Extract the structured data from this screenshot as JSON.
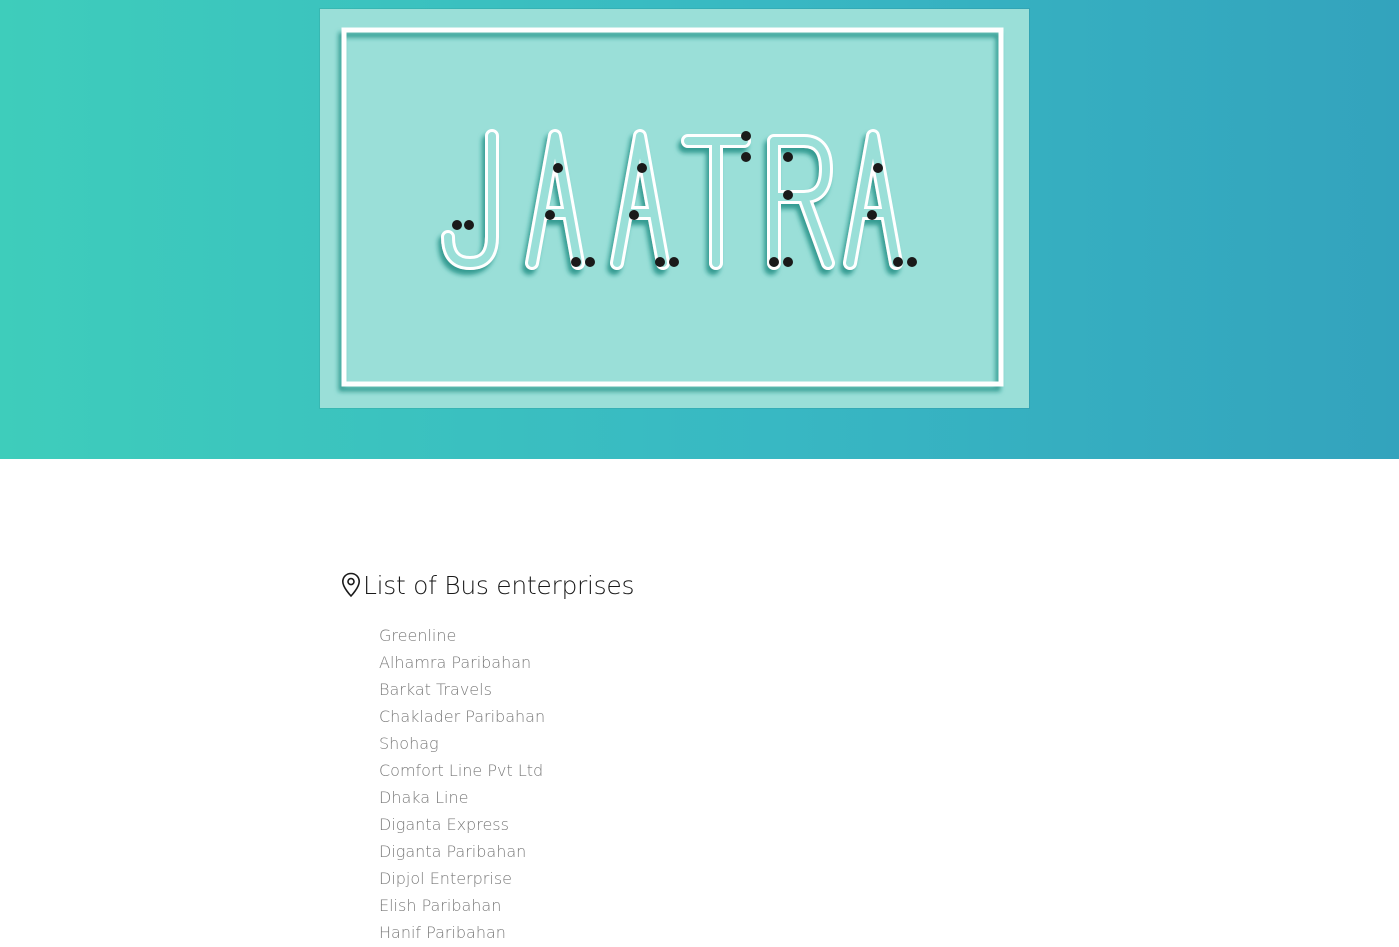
{
  "hero": {
    "logo_text": "JAATRA",
    "icon": "neon-sign-logo"
  },
  "section": {
    "icon": "map-pin-icon",
    "title": "List of Bus enterprises"
  },
  "bus_enterprises": [
    "Greenline",
    "Alhamra Paribahan",
    "Barkat Travels",
    "Chaklader Paribahan",
    "Shohag",
    "Comfort Line Pvt Ltd",
    "Dhaka Line",
    "Diganta Express",
    "Diganta Paribahan",
    "Dipjol Enterprise",
    "Elish Paribahan",
    "Hanif Paribahan"
  ],
  "colors": {
    "hero_gradient_start": "#3ecdbb",
    "hero_gradient_end": "#33a3bd",
    "logo_background": "#9adfd8",
    "list_text": "#7a7a7a"
  }
}
